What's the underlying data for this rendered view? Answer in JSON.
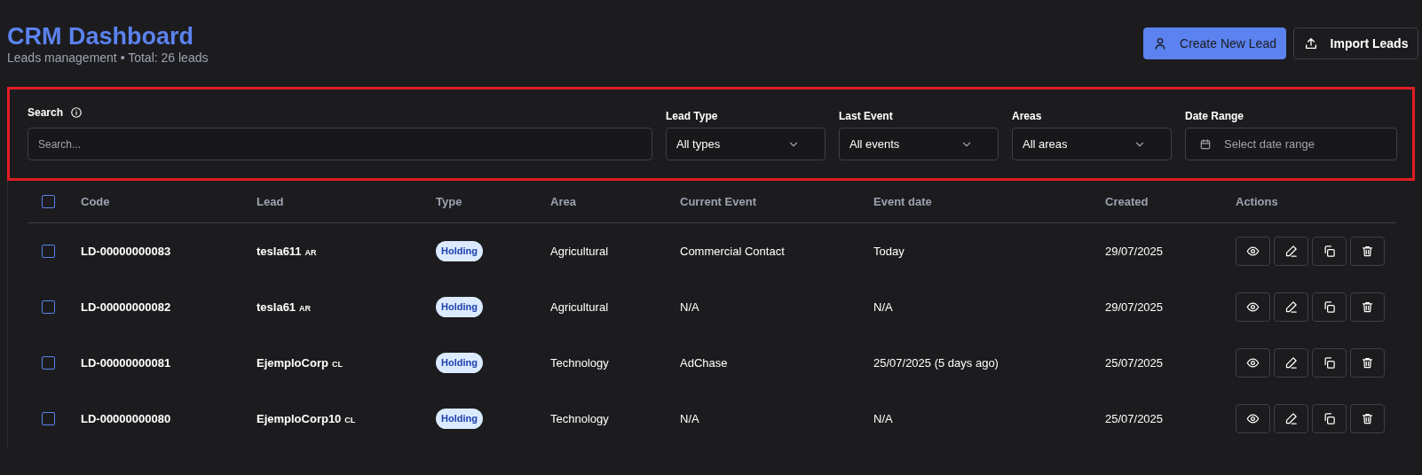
{
  "header": {
    "title": "CRM Dashboard",
    "subtitle": "Leads management • Total: 26 leads",
    "buttons": [
      {
        "label": "Create New Lead",
        "kind": "primary"
      },
      {
        "label": "Import Leads",
        "kind": "secondary"
      }
    ]
  },
  "filters": {
    "search": {
      "label": "Search",
      "placeholder": "Search..."
    },
    "selects": [
      {
        "label": "Lead Type",
        "value": "All types",
        "kind": "select"
      },
      {
        "label": "Last Event",
        "value": "All events",
        "kind": "select"
      },
      {
        "label": "Areas",
        "value": "All areas",
        "kind": "select"
      },
      {
        "label": "Date Range",
        "placeholder": "Select date range",
        "kind": "date"
      }
    ]
  },
  "table": {
    "select_all": {
      "checked": false
    },
    "columns": [
      "Code",
      "Lead",
      "Type",
      "Area",
      "Current Event",
      "Event date",
      "Created",
      "Actions"
    ],
    "rows": [
      {
        "selected": false,
        "code": "LD-00000000083",
        "lead": "tesla611",
        "country": "AR",
        "type": "Holding",
        "area": "Agricultural",
        "current_event": "Commercial Contact",
        "event_date": "Today",
        "created": "29/07/2025"
      },
      {
        "selected": false,
        "code": "LD-00000000082",
        "lead": "tesla61",
        "country": "AR",
        "type": "Holding",
        "area": "Agricultural",
        "current_event": "N/A",
        "event_date": "N/A",
        "created": "29/07/2025"
      },
      {
        "selected": false,
        "code": "LD-00000000081",
        "lead": "EjemploCorp",
        "country": "CL",
        "type": "Holding",
        "area": "Technology",
        "current_event": "AdChase",
        "event_date": "25/07/2025 (5 days ago)",
        "created": "25/07/2025"
      },
      {
        "selected": false,
        "code": "LD-00000000080",
        "lead": "EjemploCorp10",
        "country": "CL",
        "type": "Holding",
        "area": "Technology",
        "current_event": "N/A",
        "event_date": "N/A",
        "created": "25/07/2025"
      }
    ]
  }
}
